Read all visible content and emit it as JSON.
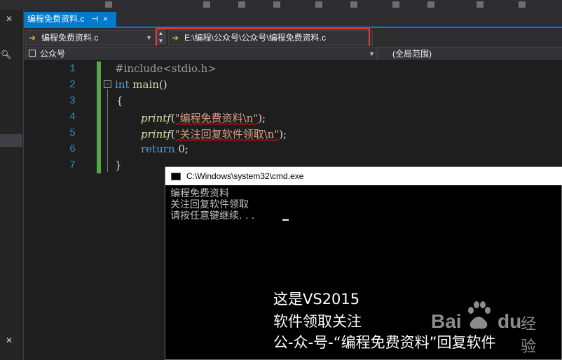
{
  "editor_tab": {
    "title": "编程免费资料.c",
    "pin": "⊣",
    "close": "×"
  },
  "navbar": {
    "file_combo": "编程免费资料.c",
    "path_combo": "E:\\编程\\公众号\\公众号\\编程免费资料.c"
  },
  "scope_bar": {
    "left": "公众号",
    "right": "(全局范围)"
  },
  "code": {
    "line_numbers": [
      "1",
      "2",
      "3",
      "4",
      "5",
      "6",
      "7"
    ],
    "l1_pp": "#include<stdio.h>",
    "l2_kw": "int",
    "l2_fn": "main",
    "l2_rest": "()",
    "l3": "{",
    "l4_fn": "printf",
    "l4_open": "(",
    "l4_str": "\"编程免费资料\\n\"",
    "l4_end": ");",
    "l5_fn": "printf",
    "l5_open": "(",
    "l5_str": "\"关注回复软件领取\\n\"",
    "l5_end": ");",
    "l6_kw": "return",
    "l6_rest": " 0;",
    "l7": "}"
  },
  "cmd": {
    "title": "C:\\Windows\\system32\\cmd.exe",
    "output": [
      "编程免费资料",
      "关注回复软件领取",
      "请按任意键继续. . ."
    ]
  },
  "overlay": [
    "这是VS2015",
    "软件领取关注",
    "公-众-号-“编程免费资料”回复软件"
  ],
  "watermark": {
    "bai": "Bai",
    "du": "du",
    "jingyan": "经验"
  },
  "icons": {
    "left_close": "close-icon",
    "search": "search-icon",
    "tab_pin": "pin-icon",
    "combo_arrow": "arrow-right-icon",
    "dropdown": "chevron-down-icon",
    "scope": "class-view-icon",
    "cmd": "console-icon"
  },
  "colors": {
    "accent": "#007acc",
    "highlight_box": "#e53935",
    "change_bar": "#57a64a",
    "keyword": "#569cd6",
    "line_number": "#2b91af"
  }
}
